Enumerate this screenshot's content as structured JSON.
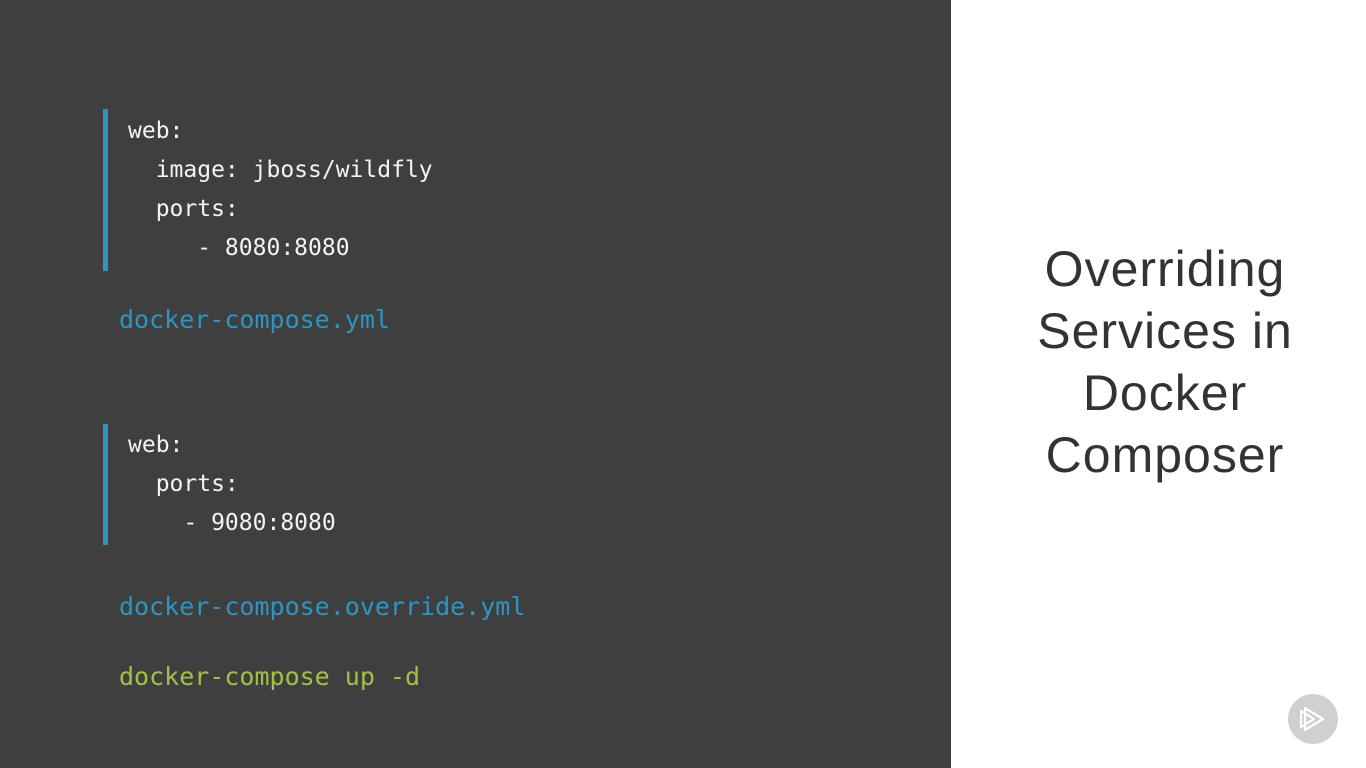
{
  "slide": {
    "code_block_1": {
      "lines": [
        "web:",
        "  image: jboss/wildfly",
        "  ports:",
        "     - 8080:8080"
      ]
    },
    "filename_1": "docker-compose.yml",
    "code_block_2": {
      "lines": [
        "web:",
        "  ports:",
        "    - 9080:8080"
      ]
    },
    "filename_2": "docker-compose.override.yml",
    "command": "docker-compose up -d",
    "title_lines": [
      "Overriding",
      "Services in",
      "Docker",
      "Composer"
    ]
  },
  "colors": {
    "left_background": "#3f3f3f",
    "right_background": "#ffffff",
    "code_text": "#f3f3f3",
    "accent_bar": "#2e95c3",
    "filename": "#2e95c3",
    "command": "#a2c143",
    "title": "#333333"
  },
  "icons": {
    "logo": "play-logo-icon"
  }
}
